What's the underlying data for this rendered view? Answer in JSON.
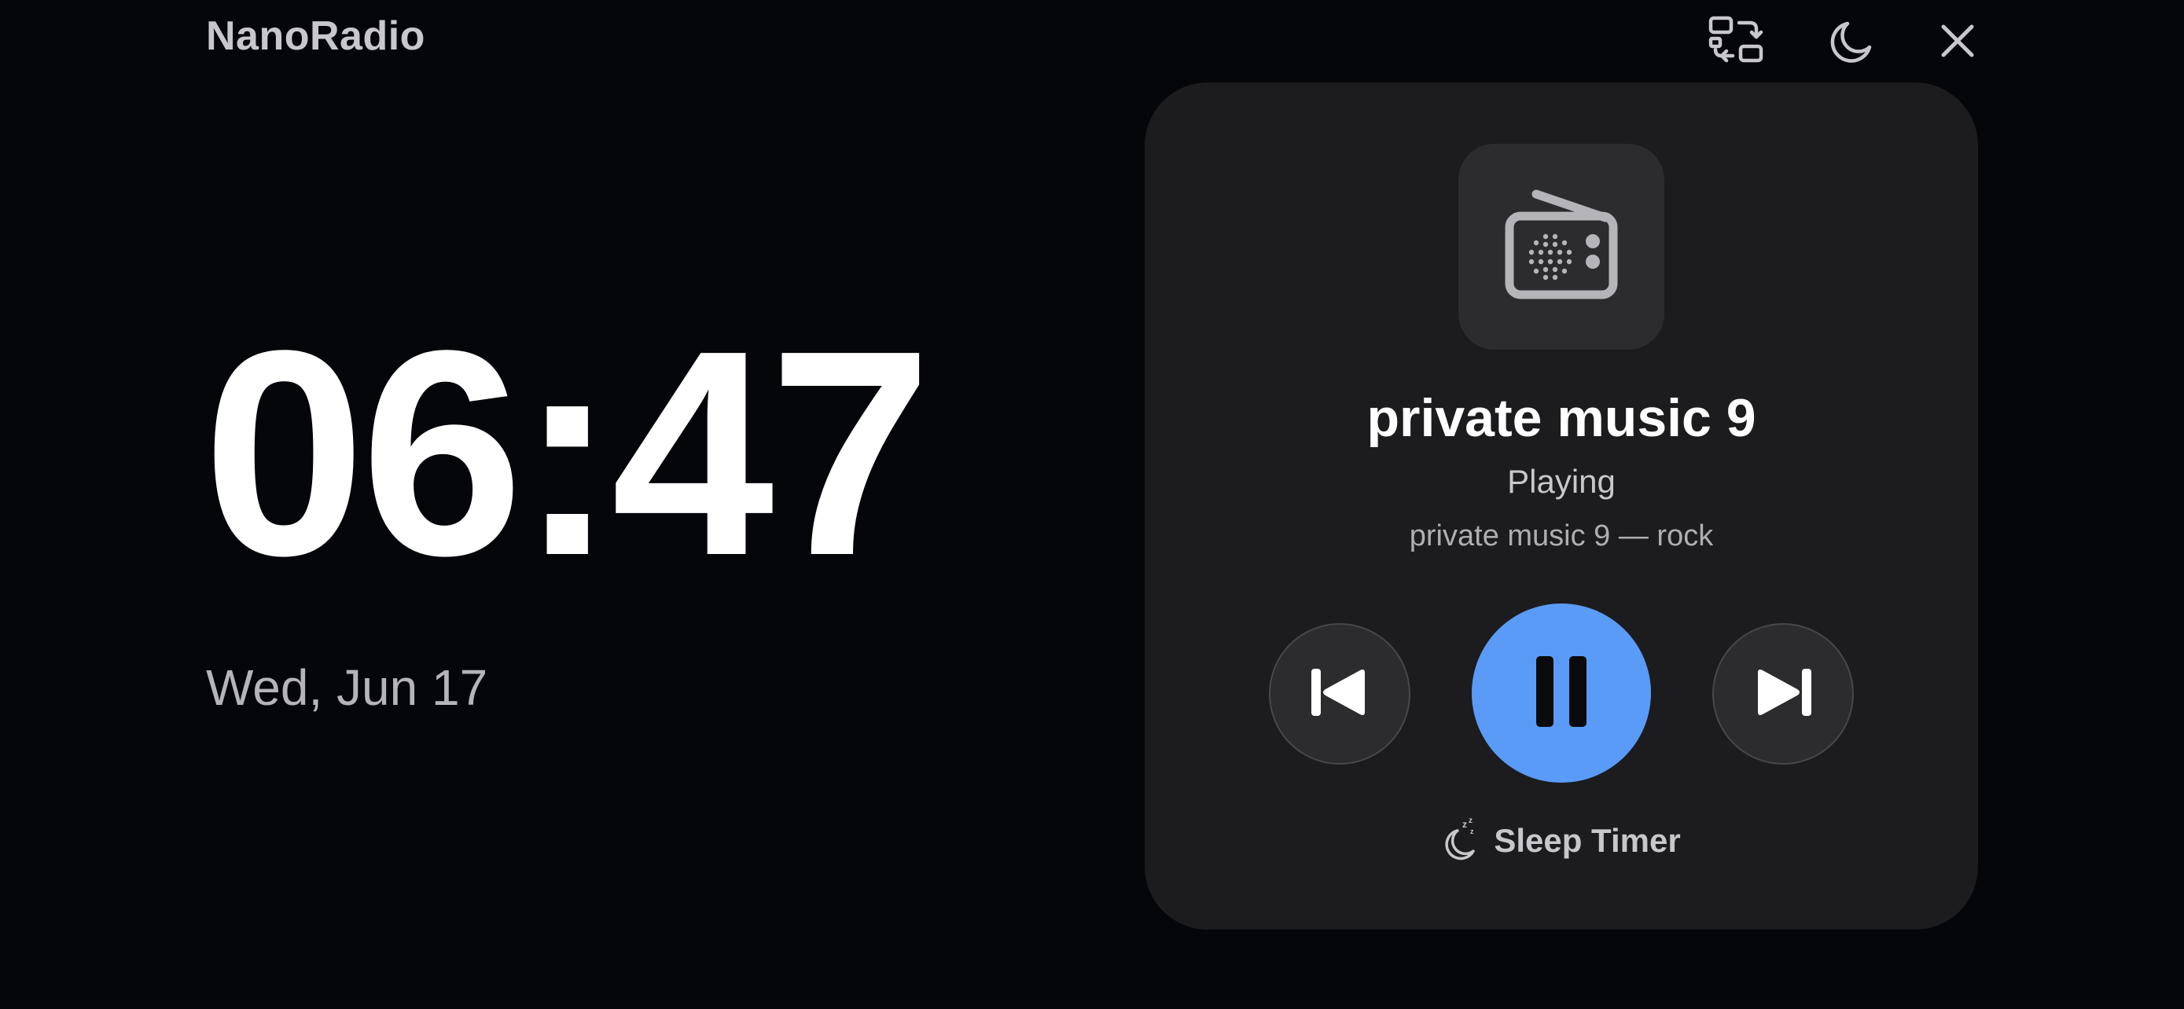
{
  "app": {
    "title": "NanoRadio"
  },
  "toolbar": {
    "switch_icon": "switch-layout-icon",
    "night_icon": "moon-icon",
    "close_icon": "close-icon"
  },
  "clock": {
    "time": "06:47",
    "date": "Wed, Jun 17"
  },
  "player": {
    "artwork_icon": "radio-icon",
    "station_name": "private music 9",
    "status": "Playing",
    "subtitle": "private music 9 — rock",
    "controls": {
      "previous_icon": "skip-back-icon",
      "pause_icon": "pause-icon",
      "next_icon": "skip-forward-icon"
    },
    "sleep_timer": {
      "icon": "sleep-moon-icon",
      "label": "Sleep Timer"
    }
  },
  "colors": {
    "background": "#05060a",
    "card": "#1c1c1e",
    "accent": "#5a9bf8",
    "text_secondary": "#c7c7cc"
  }
}
